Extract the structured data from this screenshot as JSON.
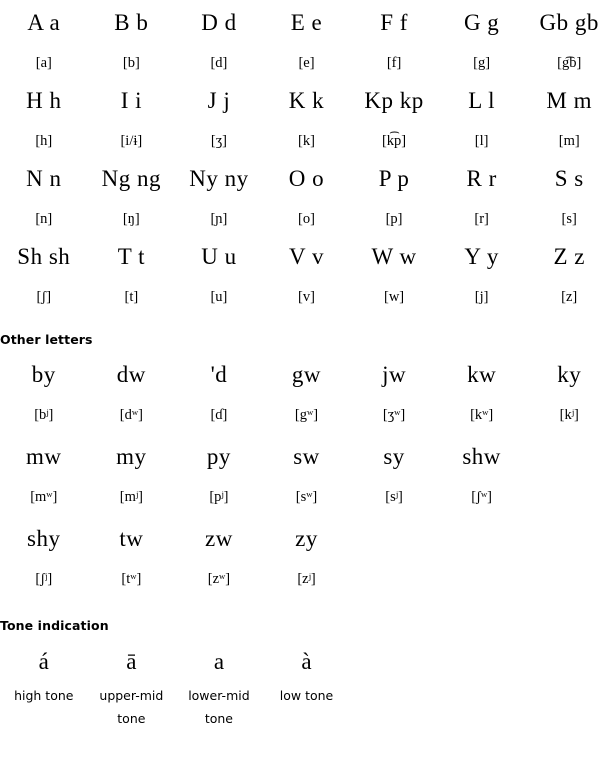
{
  "page": {
    "background_color": "#ffffff",
    "text_color": "#000000"
  },
  "sections": [
    {
      "heading": "",
      "rows": [
        {
          "letters": [
            "A a",
            "B b",
            "D d",
            "E e",
            "F f",
            "G g",
            "Gb gb"
          ],
          "ipa": [
            "[a]",
            "[b]",
            "[d]",
            "[e]",
            "[f]",
            "[g]",
            "[g͡b]"
          ]
        },
        {
          "letters": [
            "H h",
            "I i",
            "J j",
            "K k",
            "Kp kp",
            "L l",
            "M m"
          ],
          "ipa": [
            "[h]",
            "[i/ɨ]",
            "[ʒ]",
            "[k]",
            "[k͡p]",
            "[l]",
            "[m]"
          ]
        },
        {
          "letters": [
            "N n",
            "Ng ng",
            "Ny ny",
            "O o",
            "P p",
            "R r",
            "S s"
          ],
          "ipa": [
            "[n]",
            "[ŋ]",
            "[ɲ]",
            "[o]",
            "[p]",
            "[r]",
            "[s]"
          ]
        },
        {
          "letters": [
            "Sh sh",
            "T t",
            "U u",
            "V v",
            "W w",
            "Y y",
            "Z z"
          ],
          "ipa": [
            "[ʃ]",
            "[t]",
            "[u]",
            "[v]",
            "[w]",
            "[j]",
            "[z]"
          ]
        }
      ]
    }
  ],
  "other_letters": {
    "heading": "Other letters",
    "rows": [
      {
        "letters": [
          "by",
          "dw",
          "'d",
          "gw",
          "jw",
          "kw",
          "ky"
        ],
        "ipa": [
          "[bʲ]",
          "[dʷ]",
          "[ɗ]",
          "[gʷ]",
          "[ʒʷ]",
          "[kʷ]",
          "[kʲ]"
        ]
      },
      {
        "letters": [
          "mw",
          "my",
          "py",
          "sw",
          "sy",
          "shw",
          ""
        ],
        "ipa": [
          "[mʷ]",
          "[mʲ]",
          "[pʲ]",
          "[sʷ]",
          "[sʲ]",
          "[ʃʷ]",
          ""
        ]
      },
      {
        "letters": [
          "shy",
          "tw",
          "zw",
          "zy",
          "",
          "",
          ""
        ],
        "ipa": [
          "[ʃʲ]",
          "[tʷ]",
          "[zʷ]",
          "[zʲ]",
          "",
          "",
          ""
        ]
      }
    ]
  },
  "tone_indication": {
    "heading": "Tone indication",
    "marks": [
      "á",
      "ā",
      "a",
      "à",
      "",
      "",
      ""
    ],
    "labels": [
      "high tone",
      "upper-mid tone",
      "lower-mid tone",
      "low tone",
      "",
      "",
      ""
    ]
  }
}
